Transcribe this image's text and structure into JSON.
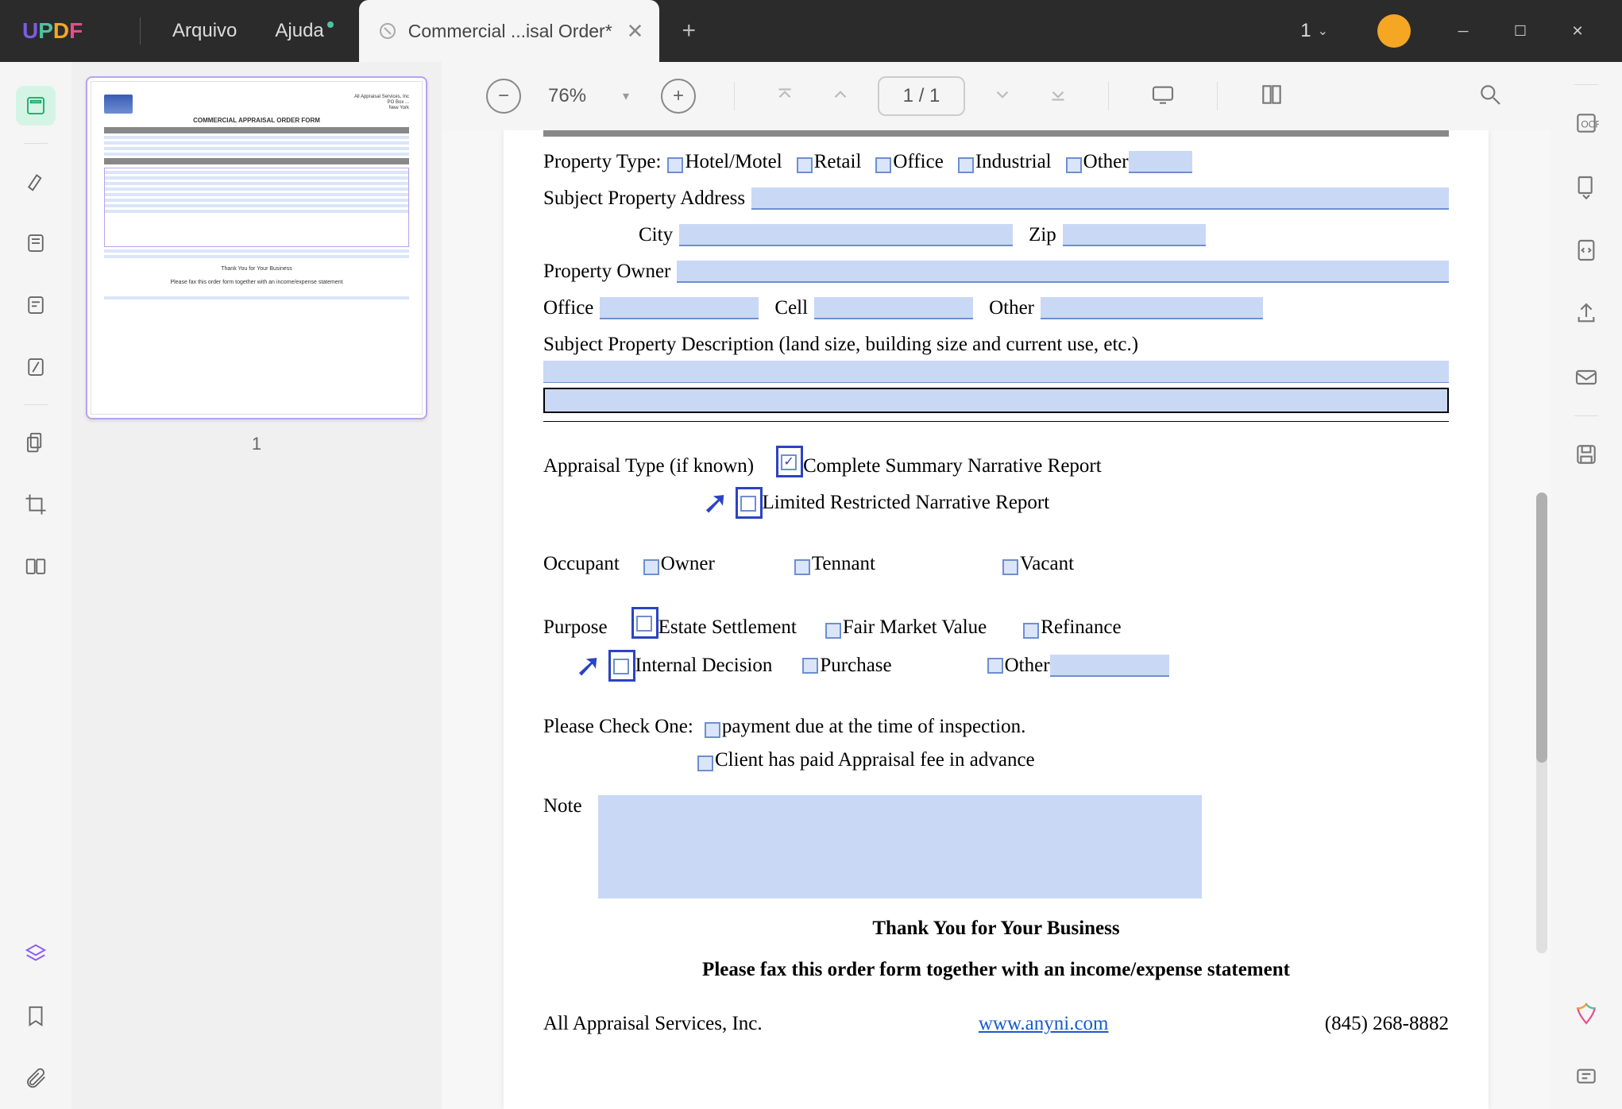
{
  "app": {
    "logo_u": "U",
    "logo_p": "P",
    "logo_d": "D",
    "logo_f": "F",
    "menu_file": "Arquivo",
    "menu_help": "Ajuda"
  },
  "tab": {
    "title": "Commercial ...isal Order*"
  },
  "window": {
    "count": "1"
  },
  "toolbar": {
    "zoom": "76%",
    "page_current": "1",
    "page_sep": "/",
    "page_total": "1"
  },
  "thumbnail": {
    "page_num": "1"
  },
  "doc": {
    "property_type_label": "Property Type:",
    "pt_hotel": "Hotel/Motel",
    "pt_retail": "Retail",
    "pt_office": "Office",
    "pt_industrial": "Industrial",
    "pt_other": "Other",
    "subject_address_label": "Subject Property Address",
    "city_label": "City",
    "zip_label": "Zip",
    "property_owner_label": "Property Owner",
    "office_label": "Office",
    "cell_label": "Cell",
    "other_label": "Other",
    "subject_desc_label": "Subject Property Description (land size, building size and current use, etc.)",
    "appraisal_label": "Appraisal Type (if known)",
    "appraisal_complete": "Complete Summary Narrative Report",
    "appraisal_limited": "Limited Restricted Narrative Report",
    "occupant_label": "Occupant",
    "occupant_owner": "Owner",
    "occupant_tennant": "Tennant",
    "occupant_vacant": "Vacant",
    "purpose_label": "Purpose",
    "purpose_estate": "Estate Settlement",
    "purpose_fmv": "Fair Market Value",
    "purpose_refinance": "Refinance",
    "purpose_internal": "Internal Decision",
    "purpose_purchase": "Purchase",
    "purpose_other": "Other",
    "checkone_label": "Please Check One:",
    "payment_due": "payment due at the time of inspection.",
    "client_paid": "Client has paid Appraisal fee in advance",
    "note_label": "Note",
    "thanks": "Thank You for Your Business",
    "fax_note": "Please fax this order form together with an income/expense statement",
    "company": "All Appraisal Services, Inc.",
    "website": "www.anyni.com",
    "phone": "(845) 268-8882"
  }
}
